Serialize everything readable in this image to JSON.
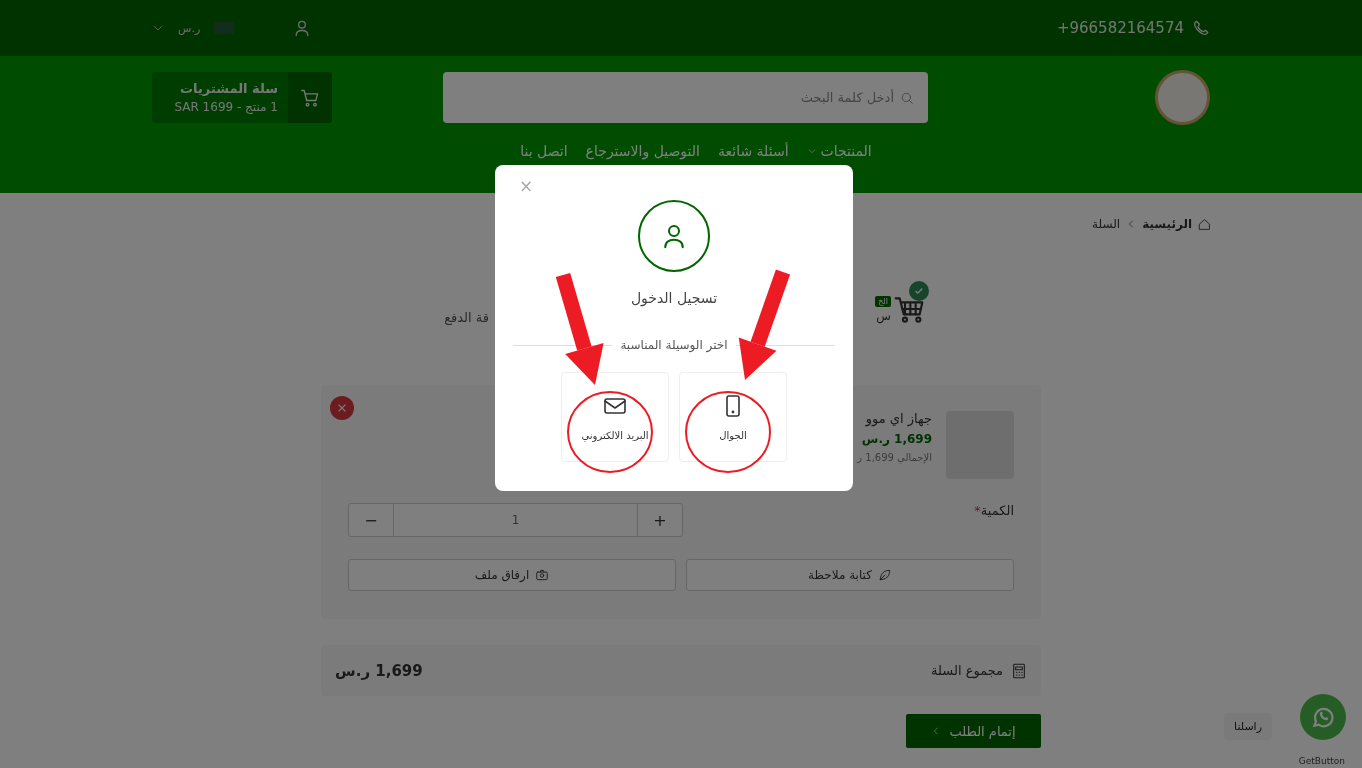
{
  "topbar": {
    "phone": "+966582164574",
    "currency": "ر.س"
  },
  "header": {
    "search": {
      "placeholder": "أدخل كلمة البحث"
    },
    "cart": {
      "title": "سلة المشتريات",
      "summary": "1 منتج - SAR 1699"
    }
  },
  "nav": [
    {
      "label": "المنتجات",
      "dropdown": true
    },
    {
      "label": "أسئلة شائعة",
      "dropdown": false
    },
    {
      "label": "التوصيل والاسترجاع",
      "dropdown": false
    },
    {
      "label": "اتصل بنا",
      "dropdown": false
    }
  ],
  "breadcrumb": [
    "الرئيسية",
    "السلة"
  ],
  "checkout_steps": [
    {
      "label": "س",
      "badge": "الخ",
      "done": true
    },
    {
      "label": "قة الدفع"
    }
  ],
  "cart_item": {
    "title": "جهاز اي موو",
    "price": "1,699 ر.س",
    "total": "الإجمالي 1,699 ر",
    "quantity_label": "الكمية",
    "required_mark": "*",
    "quantity": "1",
    "minus": "−",
    "plus": "+",
    "note_button": "كتابة ملاحظة",
    "attach_button": "ارفاق ملف"
  },
  "cart_total": {
    "label": "مجموع السلة",
    "value": "1,699 ر.س"
  },
  "checkout_button": "إتمام الطلب",
  "whatsapp": {
    "tooltip": "راسلنا",
    "credit": "GetButton"
  },
  "login_modal": {
    "close": "×",
    "title": "تسجيل الدخول",
    "prompt": "اختر الوسيلة المناسبة",
    "options": [
      {
        "kind": "phone",
        "label": "الجوال"
      },
      {
        "kind": "email",
        "label": "البريد الالكتروني"
      }
    ]
  }
}
